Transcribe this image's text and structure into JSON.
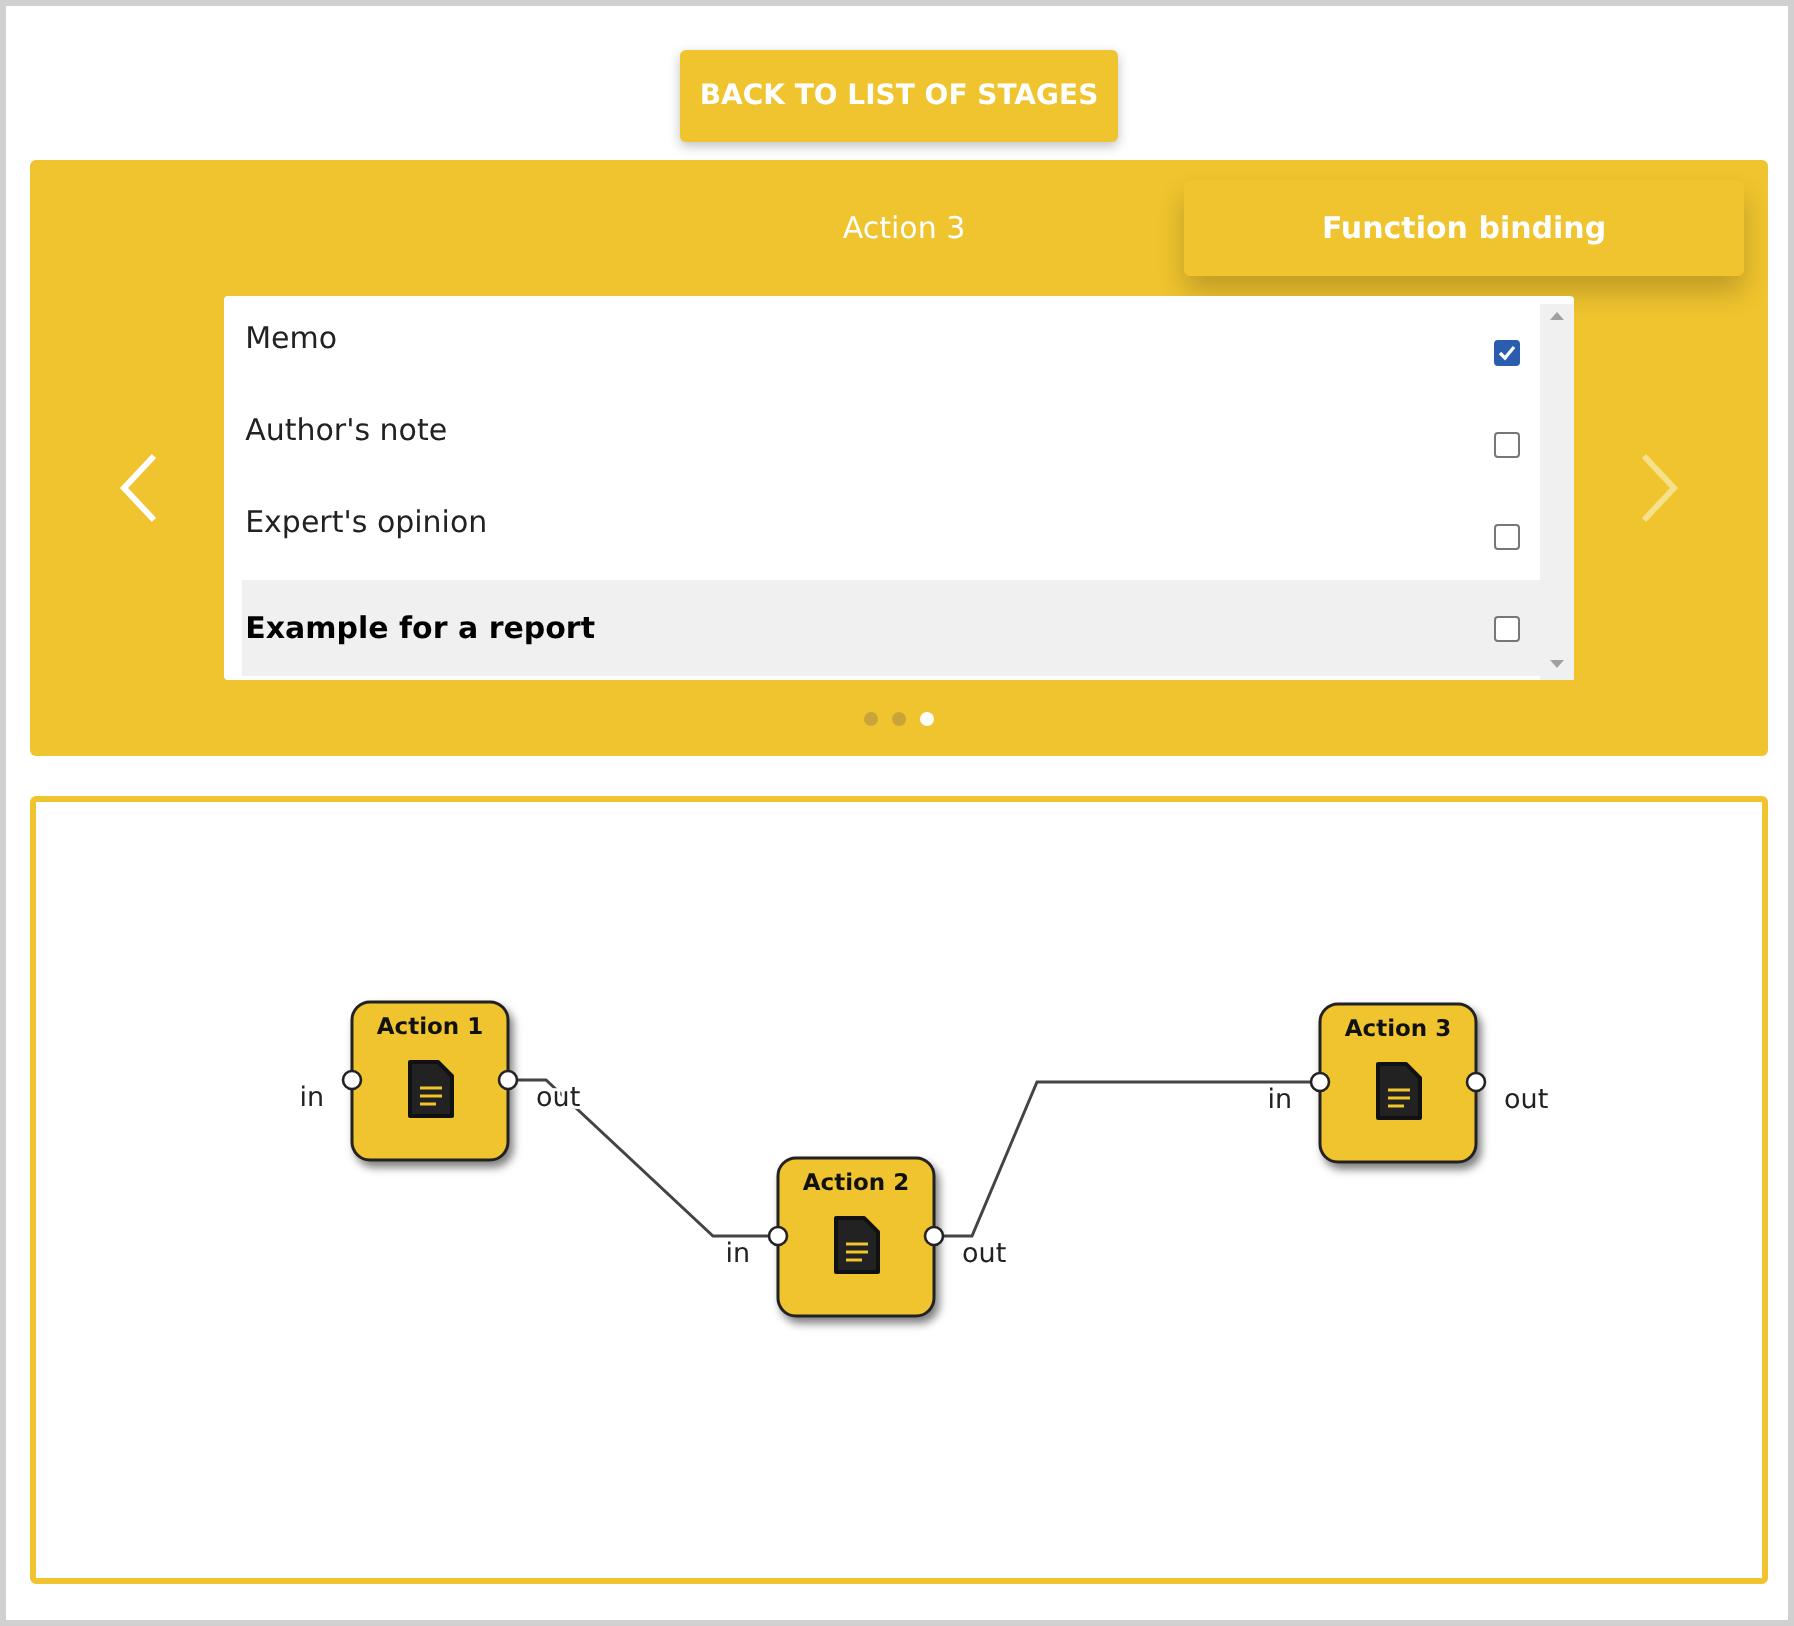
{
  "back_button": {
    "label": "BACK TO LIST OF STAGES"
  },
  "carousel": {
    "tabs": [
      {
        "label": "Action 3",
        "selected": false
      },
      {
        "label": "Function binding",
        "selected": true
      }
    ],
    "items": [
      {
        "label": "Memo",
        "checked": true,
        "selected": false
      },
      {
        "label": "Author's note",
        "checked": false,
        "selected": false
      },
      {
        "label": "Expert's opinion",
        "checked": false,
        "selected": false
      },
      {
        "label": "Example for a report",
        "checked": false,
        "selected": true
      }
    ],
    "pages": [
      {
        "selected": false
      },
      {
        "selected": false
      },
      {
        "selected": true
      }
    ]
  },
  "diagram": {
    "nodes": [
      {
        "title": "Action 1",
        "in_label": "in",
        "out_label": "out"
      },
      {
        "title": "Action 2",
        "in_label": "in",
        "out_label": "out"
      },
      {
        "title": "Action 3",
        "in_label": "in",
        "out_label": "out"
      }
    ]
  }
}
